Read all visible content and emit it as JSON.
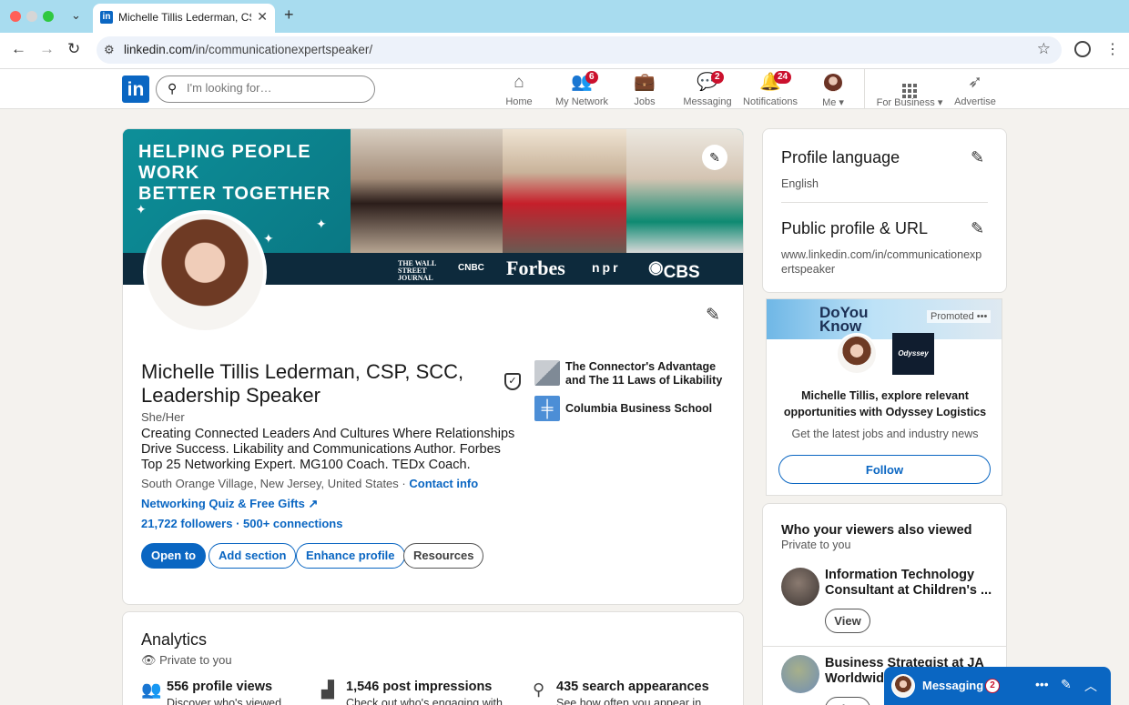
{
  "browser": {
    "tab_title": "Michelle Tillis Lederman, CSP",
    "tab_favicon": "in",
    "url_host": "linkedin.com",
    "url_path": "/in/communicationexpertspeaker/",
    "icons": [
      "chevron-down-icon",
      "close-icon",
      "plus-icon",
      "back-icon",
      "forward-icon",
      "reload-icon",
      "site-settings-icon",
      "star-icon",
      "account-icon",
      "kebab-icon"
    ]
  },
  "nav": {
    "logo": "in",
    "search_placeholder": "I'm looking for…",
    "items": [
      {
        "label": "Home",
        "icon": "home-icon"
      },
      {
        "label": "My Network",
        "icon": "network-icon",
        "badge": "6"
      },
      {
        "label": "Jobs",
        "icon": "briefcase-icon"
      },
      {
        "label": "Messaging",
        "icon": "chat-icon",
        "badge": "2"
      },
      {
        "label": "Notifications",
        "icon": "bell-icon",
        "badge": "24"
      },
      {
        "label": "Me",
        "icon": "avatar"
      },
      {
        "label": "For Business",
        "icon": "grid-icon"
      },
      {
        "label": "Advertise",
        "icon": "compass-icon"
      }
    ]
  },
  "banner": {
    "tagline_line1": "HELPING PEOPLE WORK",
    "tagline_line2": "BETTER TOGETHER",
    "press": [
      "THE WALL STREET JOURNAL",
      "CNBC",
      "Forbes",
      "npr",
      "CBS"
    ]
  },
  "profile": {
    "name": "Michelle Tillis Lederman, CSP, SCC, Leadership Speaker",
    "pronouns": "She/Her",
    "headline": "Creating Connected Leaders And Cultures Where Relationships Drive Success. Likability and Communications Author. Forbes Top 25 Networking Expert. MG100 Coach. TEDx Coach.",
    "location": "South Orange Village, New Jersey, United States",
    "location_sep": " · ",
    "contact_info": "Contact info",
    "link": "Networking Quiz & Free Gifts",
    "followers": "21,722 followers",
    "connections_sep": " · ",
    "connections": "500+ connections",
    "buttons": {
      "open_to": "Open to",
      "add_section": "Add section",
      "enhance_profile": "Enhance profile",
      "resources": "Resources"
    },
    "experience": [
      {
        "label": "The Connector's Advantage and The 11 Laws of Likability"
      },
      {
        "label": "Columbia Business School"
      }
    ]
  },
  "analytics": {
    "title": "Analytics",
    "private": "Private to you",
    "stats": [
      {
        "title": "556 profile views",
        "sub": "Discover who's viewed"
      },
      {
        "title": "1,546 post impressions",
        "sub": "Check out who's engaging with"
      },
      {
        "title": "435 search appearances",
        "sub": "See how often you appear in"
      }
    ]
  },
  "right": {
    "profile_language_title": "Profile language",
    "profile_language_value": "English",
    "public_profile_title": "Public profile & URL",
    "public_profile_url_l1": "www.linkedin.com/in/communicationexp",
    "public_profile_url_l2": "ertspeaker"
  },
  "ad": {
    "banner_text_l1": "DoYou",
    "banner_text_l2": "Know",
    "promoted": "Promoted",
    "logo_text": "Odyssey",
    "headline": "Michelle Tillis, explore relevant opportunities with Odyssey Logistics",
    "sub": "Get the latest jobs and industry news",
    "follow": "Follow"
  },
  "viewers": {
    "title": "Who your viewers also viewed",
    "private": "Private to you",
    "people": [
      {
        "name": "Information Technology Consultant at Children's ...",
        "view": "View"
      },
      {
        "name": "Business Strategist at JA Worldwide",
        "view": "View"
      }
    ]
  },
  "messaging": {
    "label": "Messaging",
    "badge": "2"
  },
  "colors": {
    "linkedin_blue": "#0a66c2",
    "badge_red": "#cb112d",
    "banner_teal": "#0f8c96"
  }
}
